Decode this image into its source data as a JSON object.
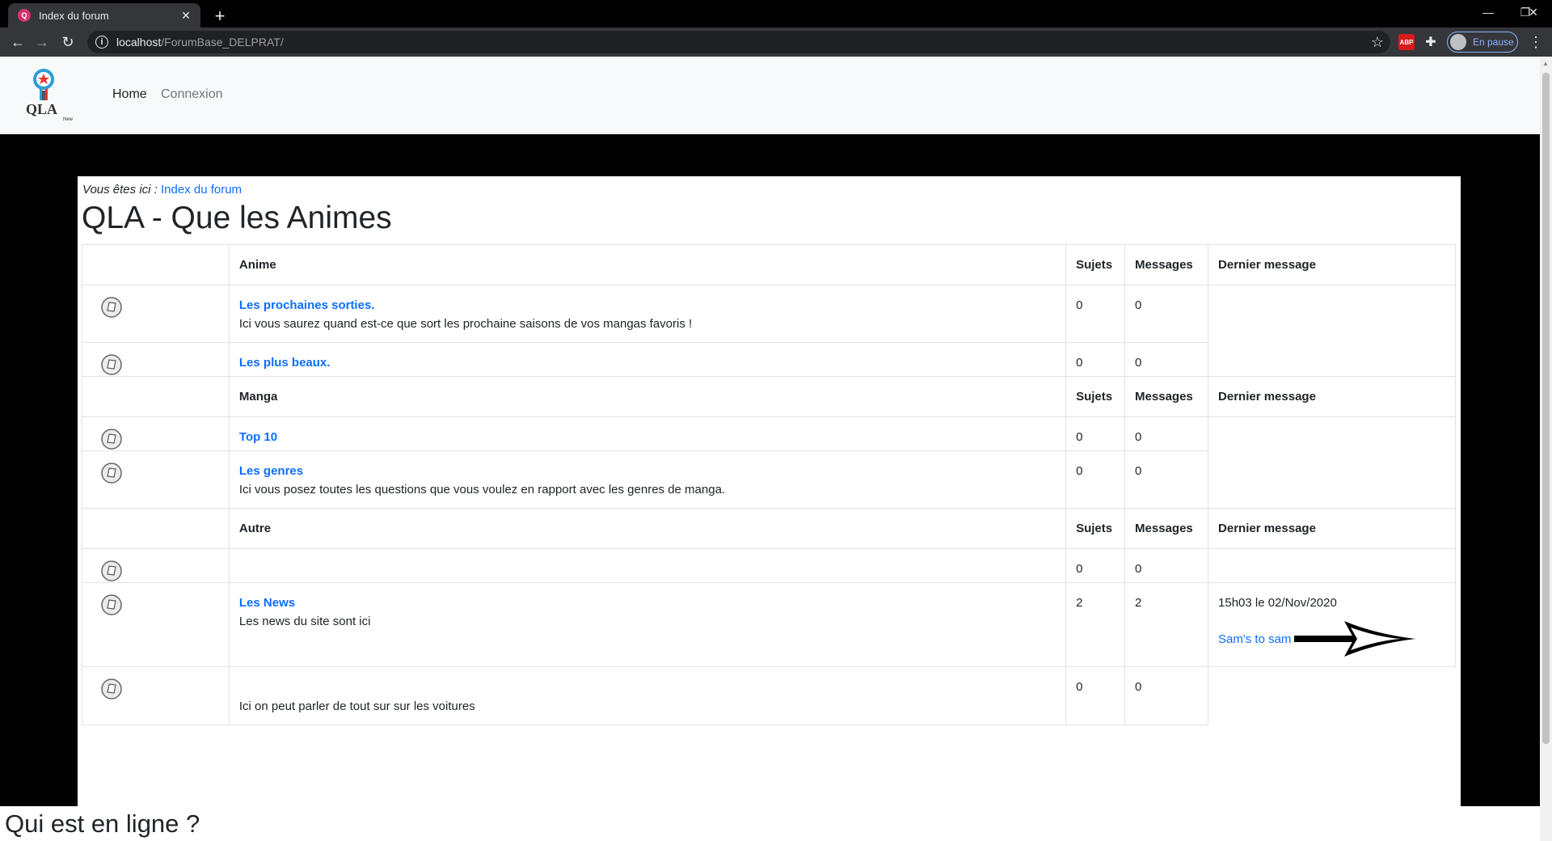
{
  "browser": {
    "tab_title": "Index du forum",
    "tab_favicon": "qla-favicon-icon",
    "url_host": "localhost",
    "url_path": "/ForumBase_DELPRAT/",
    "profile_label": "En pause",
    "extension_abp": "ABP"
  },
  "navbar": {
    "logo_text": "QLA",
    "logo_subtext": "New",
    "home": "Home",
    "connexion": "Connexion"
  },
  "breadcrumb": {
    "label": "Vous êtes ici :",
    "link": "Index du forum"
  },
  "page_title": "QLA - Que les Animes",
  "columns": {
    "sujets": "Sujets",
    "messages": "Messages",
    "last": "Dernier message"
  },
  "categories": [
    {
      "name": "Anime",
      "forums": [
        {
          "title": "Les prochaines sorties.",
          "desc": "Ici vous saurez quand est-ce que sort les prochaine saisons de vos mangas favoris !",
          "sujets": "0",
          "messages": "0"
        },
        {
          "title": "Les plus beaux.",
          "desc": "",
          "sujets": "0",
          "messages": "0"
        }
      ]
    },
    {
      "name": "Manga",
      "forums": [
        {
          "title": "Top 10",
          "desc": "",
          "sujets": "0",
          "messages": "0"
        },
        {
          "title": "Les genres",
          "desc": "Ici vous posez toutes les questions que vous voulez en rapport avec les genres de manga.",
          "sujets": "0",
          "messages": "0"
        }
      ]
    },
    {
      "name": "Autre",
      "forums": [
        {
          "title": "",
          "desc": "",
          "sujets": "0",
          "messages": "0"
        },
        {
          "title": "Les News",
          "desc": "Les news du site sont ici",
          "sujets": "2",
          "messages": "2",
          "last_date": "15h03 le 02/Nov/2020",
          "last_author": "Sam's to sam"
        },
        {
          "title": "",
          "desc": "Ici on peut parler de tout sur sur les voitures",
          "sujets": "0",
          "messages": "0"
        }
      ]
    }
  ],
  "bottom_title": "Qui est en ligne ?"
}
